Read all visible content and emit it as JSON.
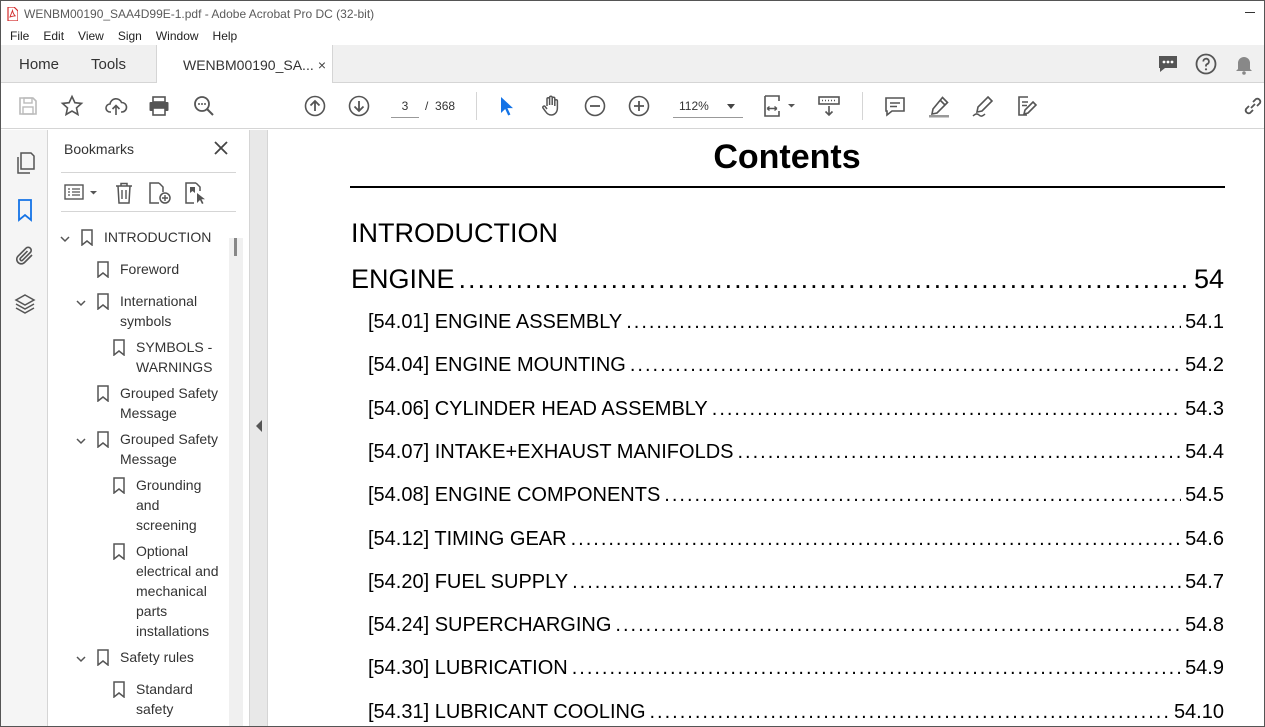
{
  "window": {
    "title": "WENBM00190_SAA4D99E-1.pdf - Adobe Acrobat Pro DC (32-bit)"
  },
  "menu": [
    "File",
    "Edit",
    "View",
    "Sign",
    "Window",
    "Help"
  ],
  "tabs": {
    "home": "Home",
    "tools": "Tools",
    "document": "WENBM00190_SA...",
    "close": "×"
  },
  "toolbar": {
    "current_page": "3",
    "page_separator": "/",
    "total_pages": "368",
    "zoom": "112%"
  },
  "bookmarks": {
    "header": "Bookmarks",
    "items": [
      {
        "label": "INTRODUCTION",
        "level": 0,
        "expanded": true
      },
      {
        "label": "Foreword",
        "level": 1,
        "expanded": null
      },
      {
        "label": "International symbols",
        "level": 1,
        "expanded": true
      },
      {
        "label": "SYMBOLS - WARNINGS",
        "level": 2,
        "expanded": null
      },
      {
        "label": "Grouped Safety Message",
        "level": 1,
        "expanded": null
      },
      {
        "label": "Grouped Safety Message",
        "level": 1,
        "expanded": true
      },
      {
        "label": "Grounding and screening",
        "level": 2,
        "expanded": null
      },
      {
        "label": "Optional electrical and mechanical parts installations",
        "level": 2,
        "expanded": null
      },
      {
        "label": "Safety rules",
        "level": 1,
        "expanded": true
      },
      {
        "label": "Standard safety",
        "level": 2,
        "expanded": null
      }
    ]
  },
  "document": {
    "title": "Contents",
    "introduction": "INTRODUCTION",
    "engine": {
      "label": "ENGINE",
      "page": "54"
    },
    "entries": [
      {
        "label": "[54.01] ENGINE ASSEMBLY",
        "page": "54.1"
      },
      {
        "label": "[54.04] ENGINE MOUNTING",
        "page": "54.2"
      },
      {
        "label": "[54.06] CYLINDER HEAD ASSEMBLY",
        "page": "54.3"
      },
      {
        "label": "[54.07] INTAKE+EXHAUST MANIFOLDS",
        "page": "54.4"
      },
      {
        "label": "[54.08] ENGINE COMPONENTS",
        "page": "54.5"
      },
      {
        "label": "[54.12] TIMING GEAR",
        "page": "54.6"
      },
      {
        "label": "[54.20] FUEL SUPPLY",
        "page": "54.7"
      },
      {
        "label": "[54.24] SUPERCHARGING",
        "page": "54.8"
      },
      {
        "label": "[54.30] LUBRICATION",
        "page": "54.9"
      },
      {
        "label": "[54.31] LUBRICANT COOLING",
        "page": "54.10"
      }
    ]
  },
  "colors": {
    "acrobat_red": "#d22b2b",
    "icon_gray": "#555555",
    "select_blue": "#1473e6"
  }
}
